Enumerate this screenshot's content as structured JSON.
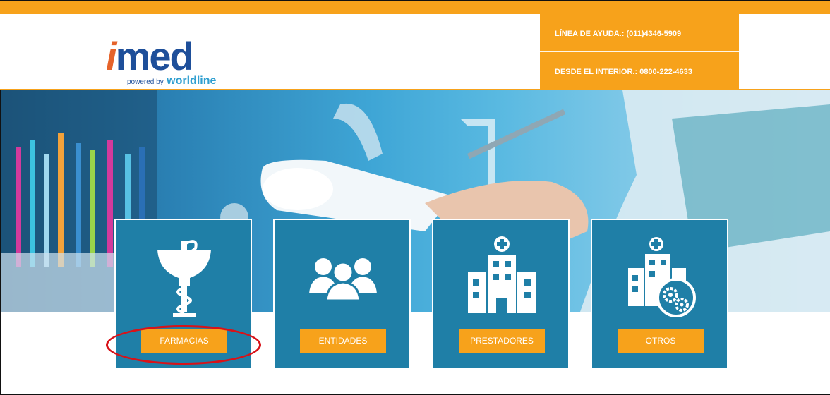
{
  "brand": {
    "logo_i": "i",
    "logo_rest": "med",
    "powered_by": "powered by",
    "brand_name": "worldline"
  },
  "help": {
    "line1": "LÍNEA DE AYUDA.: (011)4346-5909",
    "line2": "DESDE EL INTERIOR.: 0800-222-4633"
  },
  "cards": [
    {
      "label": "FARMACIAS",
      "icon": "pharmacy-icon"
    },
    {
      "label": "ENTIDADES",
      "icon": "people-icon"
    },
    {
      "label": "PRESTADORES",
      "icon": "hospital-icon"
    },
    {
      "label": "OTROS",
      "icon": "hospital-gears-icon"
    }
  ],
  "colors": {
    "accent": "#f7a21b",
    "card": "#1f7fa7",
    "logo_blue": "#1e4f9a",
    "logo_orange": "#e6632a",
    "annotation": "#d81218"
  }
}
